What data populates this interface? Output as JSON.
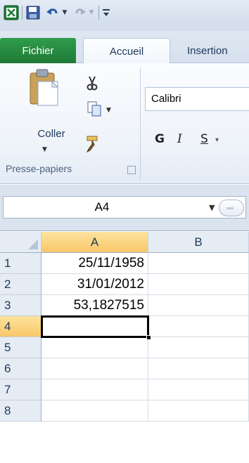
{
  "quick_access": {
    "items": [
      "excel-logo",
      "save",
      "undo",
      "redo",
      "customize"
    ]
  },
  "ribbon_tabs": [
    {
      "label": "Fichier"
    },
    {
      "label": "Accueil"
    },
    {
      "label": "Insertion"
    }
  ],
  "clipboard": {
    "paste_label": "Coller",
    "group_label": "Presse-papiers"
  },
  "font": {
    "name": "Calibri",
    "bold": "G",
    "italic": "I",
    "strikethrough": "S"
  },
  "formula_bar": {
    "name_box": "A4"
  },
  "grid": {
    "columns": [
      "A",
      "B"
    ],
    "rows": [
      "1",
      "2",
      "3",
      "4",
      "5",
      "6",
      "7",
      "8"
    ],
    "active_cell": "A4",
    "cells": [
      [
        "25/11/1958",
        ""
      ],
      [
        "31/01/2012",
        ""
      ],
      [
        "53,1827515",
        ""
      ],
      [
        "",
        ""
      ],
      [
        "",
        ""
      ],
      [
        "",
        ""
      ],
      [
        "",
        ""
      ],
      [
        "",
        ""
      ]
    ]
  },
  "colors": {
    "file_tab": "#1f7a36",
    "active_header": "#f8c76a",
    "ribbon_text": "#1e395b"
  }
}
